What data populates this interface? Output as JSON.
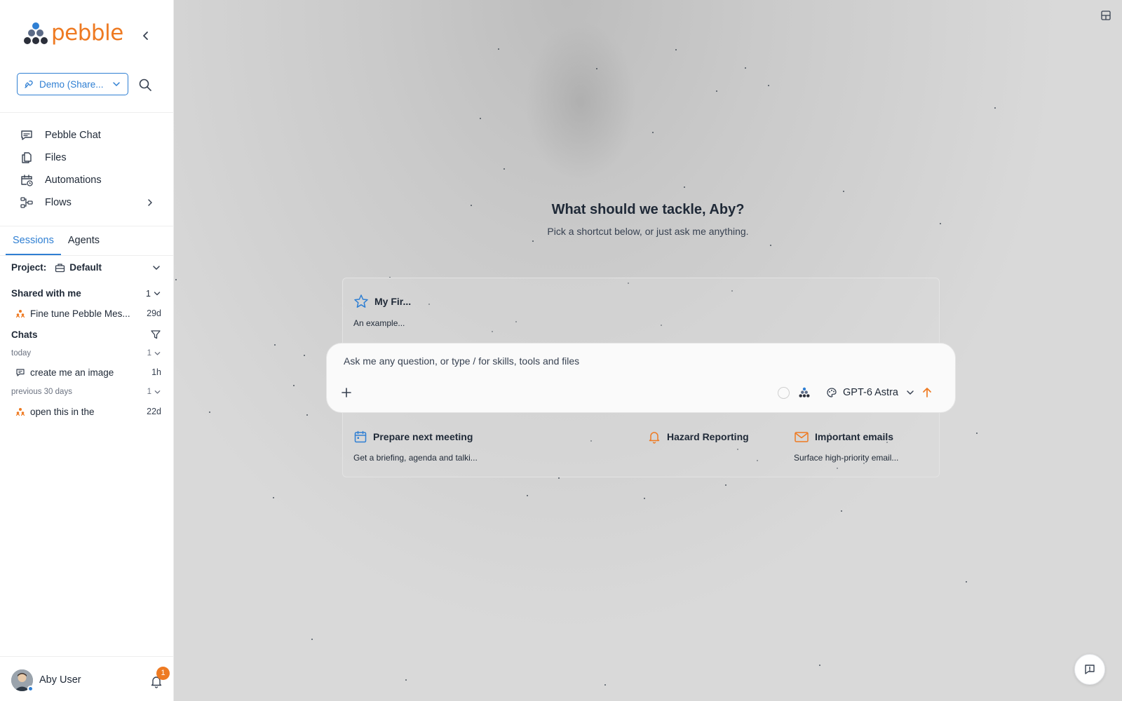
{
  "brand": {
    "name": "pebble",
    "color": "#ee7a22",
    "accent": "#2f7fd3"
  },
  "workspace": {
    "label": "Demo (Share...",
    "icon": "link-icon"
  },
  "nav": [
    {
      "label": "Pebble Chat",
      "icon": "chat-icon"
    },
    {
      "label": "Files",
      "icon": "files-icon"
    },
    {
      "label": "Automations",
      "icon": "calendar-clock-icon"
    },
    {
      "label": "Flows",
      "icon": "flows-icon",
      "has_submenu": true
    }
  ],
  "tabs": [
    {
      "label": "Sessions",
      "active": true
    },
    {
      "label": "Agents",
      "active": false
    }
  ],
  "project": {
    "key": "Project:",
    "value": "Default"
  },
  "shared": {
    "label": "Shared with me",
    "count": "1",
    "items": [
      {
        "title": "Fine tune Pebble Mes...",
        "age": "29d"
      }
    ]
  },
  "chats": {
    "label": "Chats",
    "groups": [
      {
        "label": "today",
        "count": "1",
        "items": [
          {
            "title": "create me an image",
            "age": "1h"
          }
        ]
      },
      {
        "label": "previous 30 days",
        "count": "1",
        "items": [
          {
            "title": "open this in the",
            "age": "22d"
          }
        ]
      }
    ]
  },
  "user": {
    "name": "Aby User",
    "notifications": "1"
  },
  "main": {
    "heading": "What should we tackle, Aby?",
    "subheading": "Pick a shortcut below, or just ask me anything.",
    "shortcuts": [
      {
        "title": "My Fir...",
        "desc": "An example...",
        "icon": "star-icon"
      },
      {
        "title": "Prepare next meeting",
        "desc": "Get a briefing, agenda and talki...",
        "icon": "calendar-icon"
      },
      {
        "title": "Hazard Reporting",
        "desc": "",
        "icon": "bell-icon"
      },
      {
        "title": "Important emails",
        "desc": "Surface high-priority email...",
        "icon": "mail-icon"
      }
    ],
    "composer": {
      "placeholder": "Ask me any question, or type / for skills, tools and files",
      "model": "GPT-6 Astra"
    }
  }
}
